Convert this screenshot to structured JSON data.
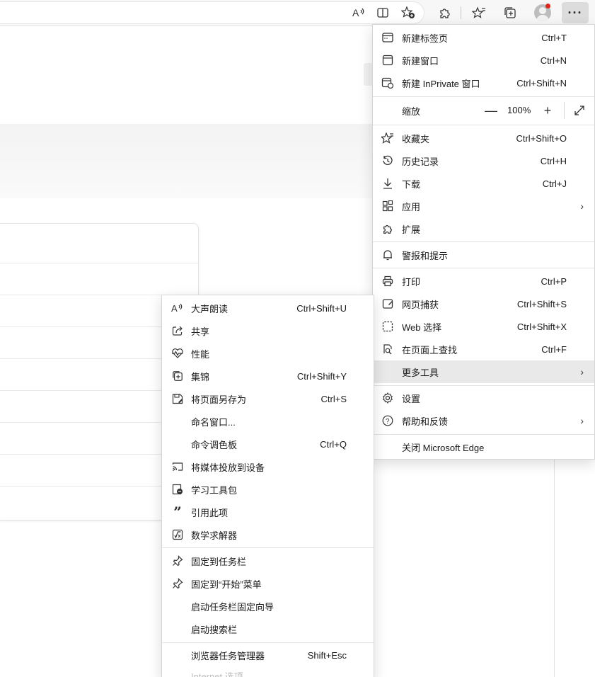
{
  "toolbar": {
    "icons": [
      "read-aloud-icon",
      "split-screen-icon",
      "add-favorite-icon",
      "extensions-icon",
      "favorites-icon",
      "collections-icon",
      "profile-avatar",
      "more-icon"
    ],
    "more_label": "···"
  },
  "main_menu": {
    "items": [
      {
        "label": "新建标签页",
        "shortcut": "Ctrl+T",
        "icon": "new-tab-icon"
      },
      {
        "label": "新建窗口",
        "shortcut": "Ctrl+N",
        "icon": "new-window-icon"
      },
      {
        "label": "新建 InPrivate 窗口",
        "shortcut": "Ctrl+Shift+N",
        "icon": "inprivate-icon"
      },
      {
        "label": "收藏夹",
        "shortcut": "Ctrl+Shift+O",
        "icon": "favorites-icon"
      },
      {
        "label": "历史记录",
        "shortcut": "Ctrl+H",
        "icon": "history-icon"
      },
      {
        "label": "下载",
        "shortcut": "Ctrl+J",
        "icon": "download-icon"
      },
      {
        "label": "应用",
        "shortcut": "",
        "icon": "apps-icon"
      },
      {
        "label": "扩展",
        "shortcut": "",
        "icon": "extensions-icon"
      },
      {
        "label": "警报和提示",
        "shortcut": "",
        "icon": "bell-icon"
      },
      {
        "label": "打印",
        "shortcut": "Ctrl+P",
        "icon": "print-icon"
      },
      {
        "label": "网页捕获",
        "shortcut": "Ctrl+Shift+S",
        "icon": "web-capture-icon"
      },
      {
        "label": "Web 选择",
        "shortcut": "Ctrl+Shift+X",
        "icon": "web-select-icon"
      },
      {
        "label": "在页面上查找",
        "shortcut": "Ctrl+F",
        "icon": "find-icon"
      },
      {
        "label": "更多工具",
        "shortcut": "",
        "icon": ""
      },
      {
        "label": "设置",
        "shortcut": "",
        "icon": "gear-icon"
      },
      {
        "label": "帮助和反馈",
        "shortcut": "",
        "icon": "help-icon"
      },
      {
        "label": "关闭 Microsoft Edge",
        "shortcut": "",
        "icon": ""
      }
    ],
    "zoom": {
      "label": "缩放",
      "value": "100%",
      "minus": "—",
      "plus": "+"
    }
  },
  "more_tools_menu": {
    "items": [
      {
        "label": "大声朗读",
        "shortcut": "Ctrl+Shift+U",
        "icon": "read-aloud-icon"
      },
      {
        "label": "共享",
        "shortcut": "",
        "icon": "share-icon"
      },
      {
        "label": "性能",
        "shortcut": "",
        "icon": "performance-icon"
      },
      {
        "label": "集锦",
        "shortcut": "Ctrl+Shift+Y",
        "icon": "collections-icon"
      },
      {
        "label": "将页面另存为",
        "shortcut": "Ctrl+S",
        "icon": "save-page-icon"
      },
      {
        "label": "命名窗口...",
        "shortcut": "",
        "icon": ""
      },
      {
        "label": "命令调色板",
        "shortcut": "Ctrl+Q",
        "icon": ""
      },
      {
        "label": "将媒体投放到设备",
        "shortcut": "",
        "icon": "cast-icon"
      },
      {
        "label": "学习工具包",
        "shortcut": "",
        "icon": "learning-toolkit-icon"
      },
      {
        "label": "引用此项",
        "shortcut": "",
        "icon": "quote-icon"
      },
      {
        "label": "数学求解器",
        "shortcut": "",
        "icon": "math-solver-icon"
      },
      {
        "label": "固定到任务栏",
        "shortcut": "",
        "icon": "pin-icon"
      },
      {
        "label": "固定到“开始”菜单",
        "shortcut": "",
        "icon": "pin-icon"
      },
      {
        "label": "启动任务栏固定向导",
        "shortcut": "",
        "icon": ""
      },
      {
        "label": "启动搜索栏",
        "shortcut": "",
        "icon": ""
      },
      {
        "label": "浏览器任务管理器",
        "shortcut": "Shift+Esc",
        "icon": ""
      },
      {
        "label": "Internet 选项",
        "shortcut": "",
        "icon": ""
      }
    ]
  }
}
